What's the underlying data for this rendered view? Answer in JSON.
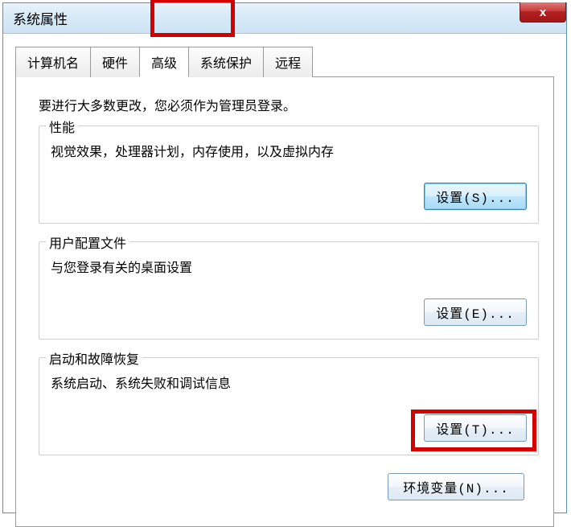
{
  "window": {
    "title": "系统属性",
    "close_glyph": "x"
  },
  "tabs": [
    {
      "label": "计算机名"
    },
    {
      "label": "硬件"
    },
    {
      "label": "高级"
    },
    {
      "label": "系统保护"
    },
    {
      "label": "远程"
    }
  ],
  "intro": "要进行大多数更改，您必须作为管理员登录。",
  "groups": {
    "performance": {
      "legend": "性能",
      "desc": "视觉效果，处理器计划，内存使用，以及虚拟内存",
      "button": "设置(S)..."
    },
    "profiles": {
      "legend": "用户配置文件",
      "desc": "与您登录有关的桌面设置",
      "button": "设置(E)..."
    },
    "startup": {
      "legend": "启动和故障恢复",
      "desc": "系统启动、系统失败和调试信息",
      "button": "设置(T)..."
    }
  },
  "env_button": "环境变量(N)..."
}
